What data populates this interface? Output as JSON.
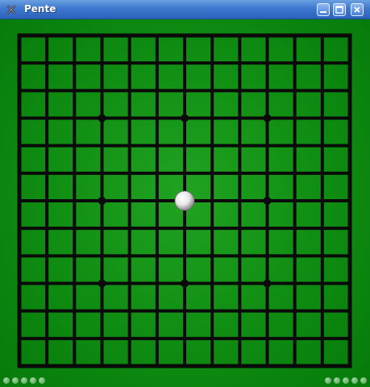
{
  "window": {
    "title": "Pente",
    "icon": "pente-app-icon",
    "buttons": [
      "minimize-icon",
      "maximize-icon",
      "close-icon"
    ]
  },
  "board": {
    "grid_lines": 13,
    "star_points": [
      [
        3,
        3
      ],
      [
        3,
        6
      ],
      [
        3,
        9
      ],
      [
        6,
        3
      ],
      [
        6,
        9
      ],
      [
        9,
        3
      ],
      [
        9,
        6
      ],
      [
        9,
        9
      ]
    ],
    "stones": [
      {
        "row": 6,
        "col": 6,
        "color": "white"
      }
    ],
    "colors": {
      "felt": "#0f8c12",
      "line": "#0a0a0a",
      "white_stone": "#e8e8e8"
    }
  },
  "status": {
    "left_captures": 5,
    "right_captures": 5
  }
}
